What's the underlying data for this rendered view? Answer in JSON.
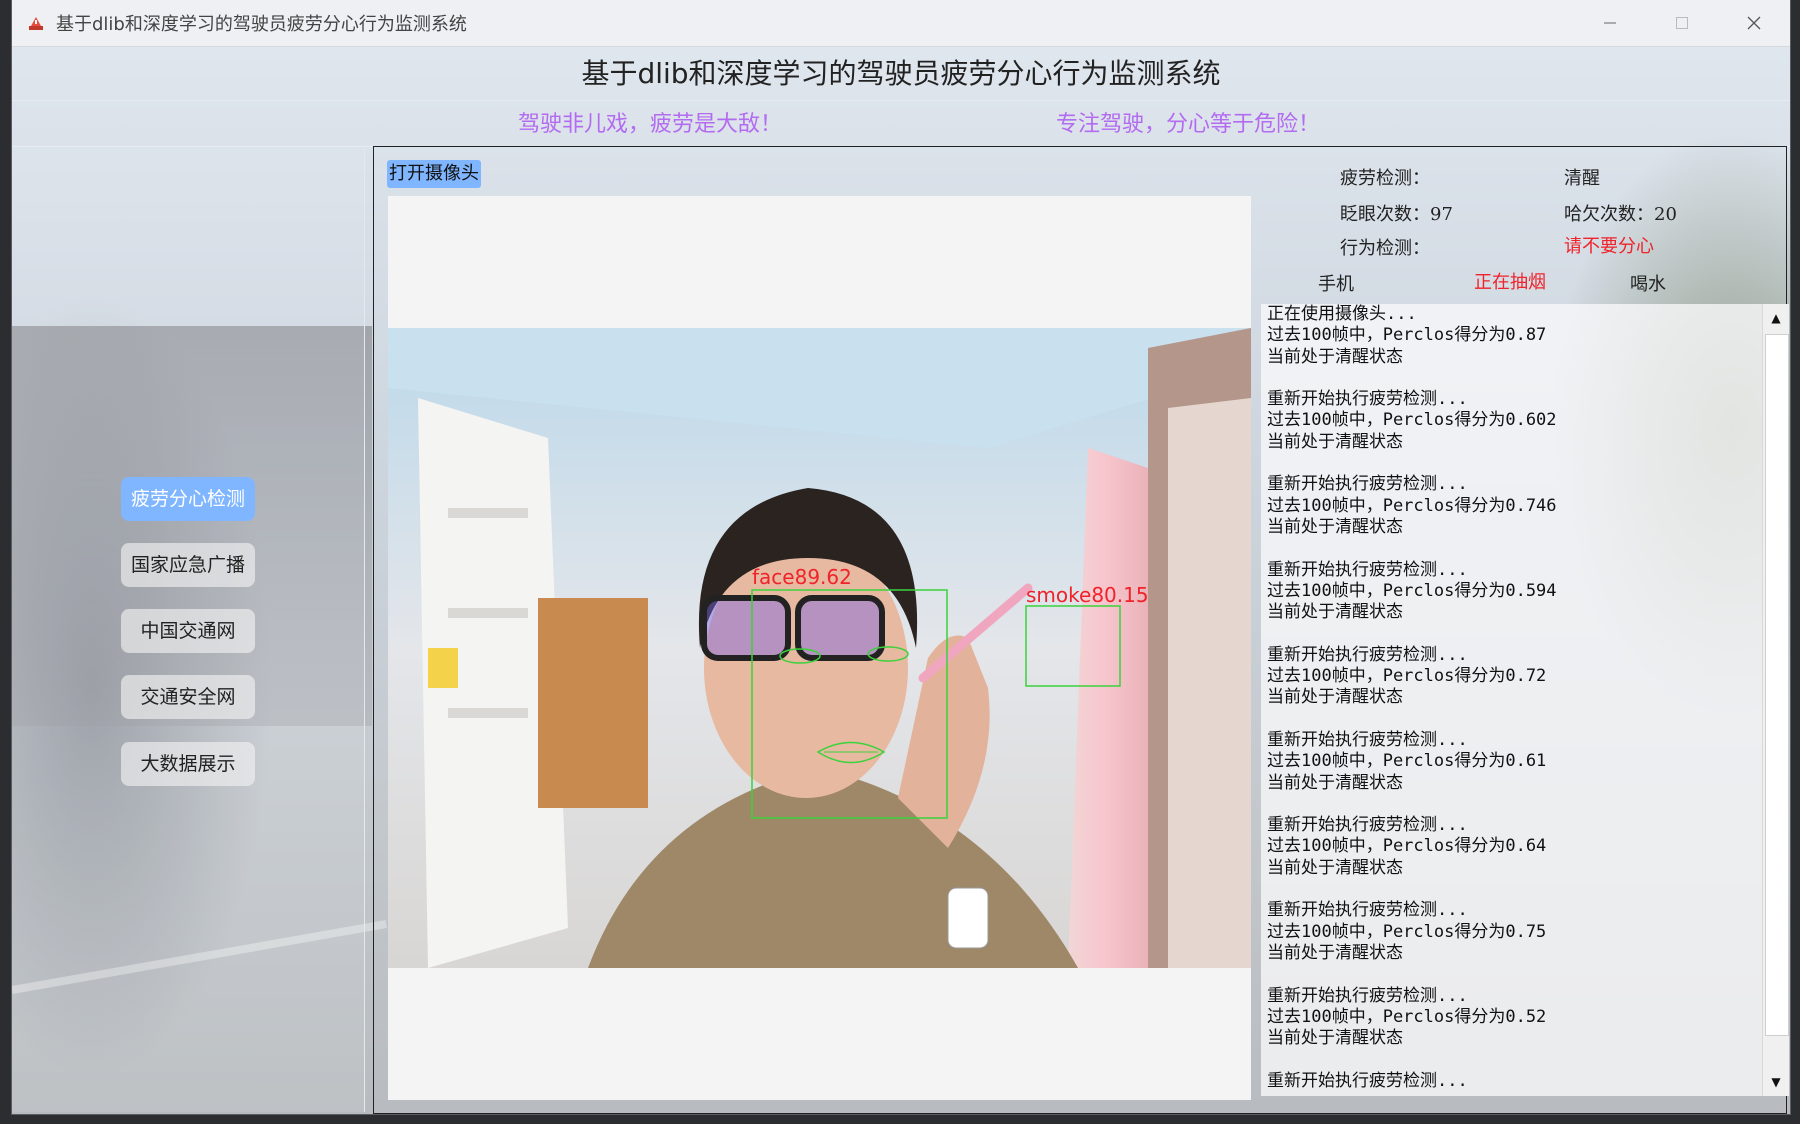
{
  "window": {
    "title": "基于dlib和深度学习的驾驶员疲劳分心行为监测系统",
    "minimize_icon": "minimize-icon",
    "maximize_icon": "maximize-icon",
    "close_icon": "close-icon"
  },
  "header": {
    "title": "基于dlib和深度学习的驾驶员疲劳分心行为监测系统",
    "slogan_left": "驾驶非儿戏，疲劳是大敌！",
    "slogan_right": "专注驾驶，分心等于危险！"
  },
  "sidebar": {
    "items": [
      {
        "label": "疲劳分心检测",
        "active": true
      },
      {
        "label": "国家应急广播",
        "active": false
      },
      {
        "label": "中国交通网",
        "active": false
      },
      {
        "label": "交通安全网",
        "active": false
      },
      {
        "label": "大数据展示",
        "active": false
      }
    ]
  },
  "camera": {
    "open_button_label": "打开摄像头",
    "detections": [
      {
        "label": "face89.62",
        "color": "#f0222a"
      },
      {
        "label": "smoke80.15",
        "color": "#f0222a"
      }
    ]
  },
  "status": {
    "fatigue_label": "疲劳检测：",
    "fatigue_value": "清醒",
    "blink_label": "眨眼次数：97",
    "yawn_label": "哈欠次数：20",
    "behavior_label": "行为检测：",
    "behavior_value": "请不要分心",
    "phone_label": "手机",
    "smoking_label": "正在抽烟",
    "drinking_label": "喝水"
  },
  "log": {
    "blocks": [
      [
        "正在使用摄像头...",
        "过去100帧中，Perclos得分为0.87",
        "当前处于清醒状态"
      ],
      [
        "重新开始执行疲劳检测...",
        "过去100帧中，Perclos得分为0.602",
        "当前处于清醒状态"
      ],
      [
        "重新开始执行疲劳检测...",
        "过去100帧中，Perclos得分为0.746",
        "当前处于清醒状态"
      ],
      [
        "重新开始执行疲劳检测...",
        "过去100帧中，Perclos得分为0.594",
        "当前处于清醒状态"
      ],
      [
        "重新开始执行疲劳检测...",
        "过去100帧中，Perclos得分为0.72",
        "当前处于清醒状态"
      ],
      [
        "重新开始执行疲劳检测...",
        "过去100帧中，Perclos得分为0.61",
        "当前处于清醒状态"
      ],
      [
        "重新开始执行疲劳检测...",
        "过去100帧中，Perclos得分为0.64",
        "当前处于清醒状态"
      ],
      [
        "重新开始执行疲劳检测...",
        "过去100帧中，Perclos得分为0.75",
        "当前处于清醒状态"
      ],
      [
        "重新开始执行疲劳检测...",
        "过去100帧中，Perclos得分为0.52",
        "当前处于清醒状态"
      ],
      [
        "重新开始执行疲劳检测..."
      ]
    ]
  },
  "colors": {
    "accent": "#7fb6ff",
    "slogan": "#b36bf0",
    "alert": "#f0222a",
    "detect_box": "#3bd23b"
  }
}
